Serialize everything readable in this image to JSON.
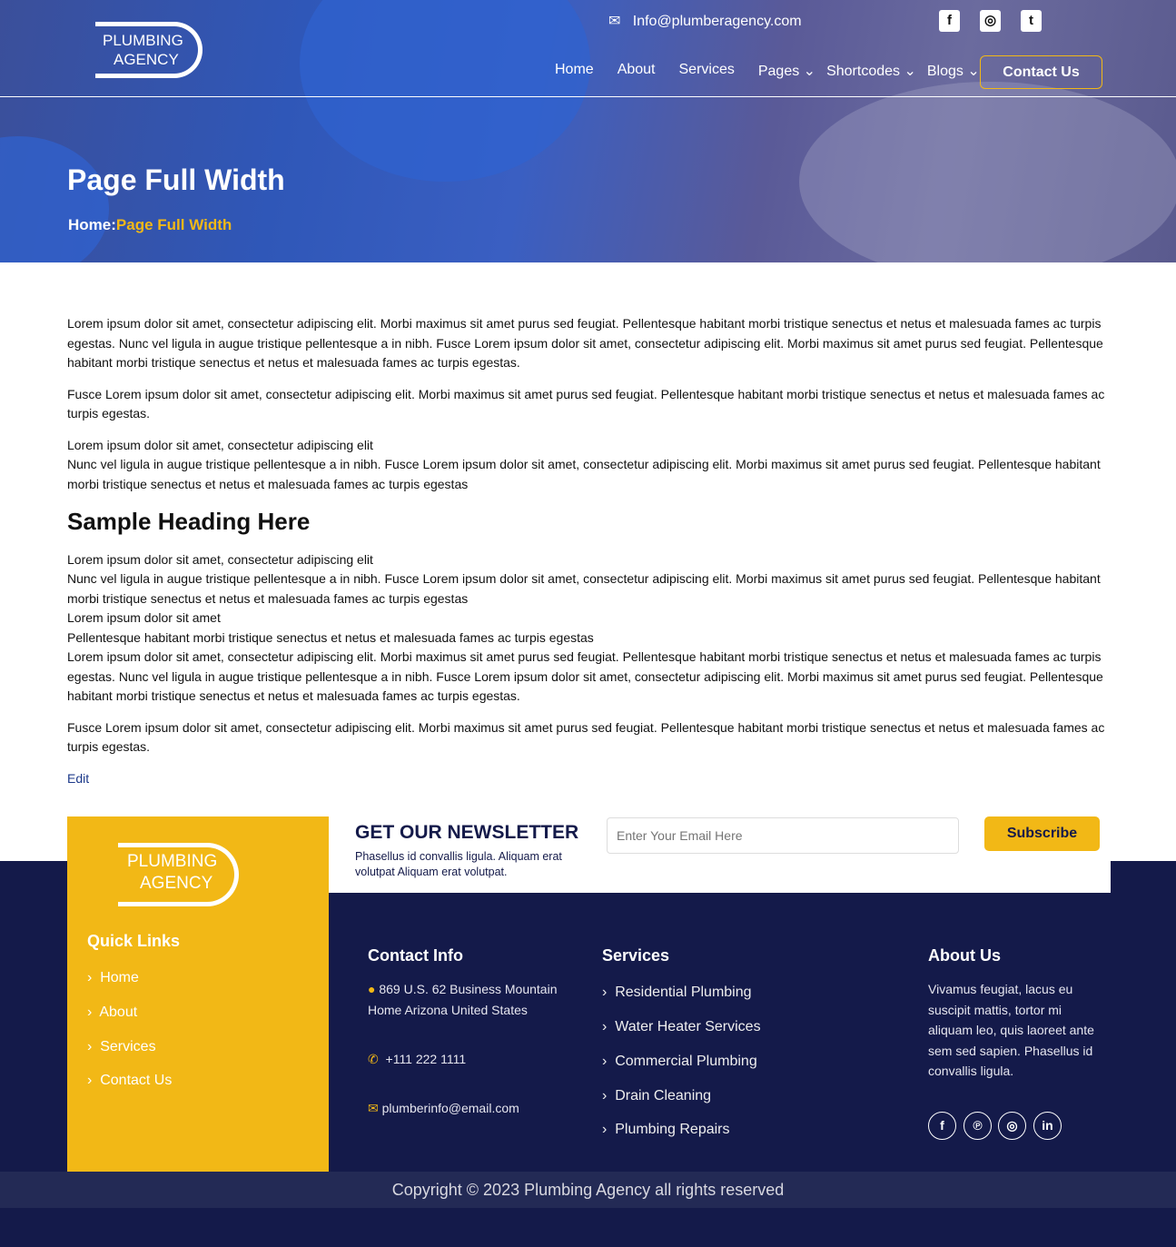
{
  "header": {
    "logo_line1": "PLUMBING",
    "logo_line2": "AGENCY",
    "email": "Info@plumberagency.com",
    "social": [
      "f",
      "◎",
      "t"
    ],
    "nav": [
      {
        "label": "Home"
      },
      {
        "label": "About"
      },
      {
        "label": "Services"
      },
      {
        "label": "Pages ⌄"
      },
      {
        "label": "Shortcodes ⌄"
      },
      {
        "label": "Blogs ⌄"
      }
    ],
    "contact_button": "Contact Us"
  },
  "hero": {
    "title": "Page Full Width",
    "breadcrumb_home": "Home",
    "breadcrumb_sep": ":",
    "breadcrumb_current": "Page Full Width"
  },
  "content": {
    "p1": "Lorem ipsum dolor sit amet, consectetur adipiscing elit. Morbi maximus sit amet purus sed feugiat. Pellentesque habitant morbi tristique senectus et netus et malesuada fames ac turpis egestas. Nunc vel ligula in augue tristique pellentesque a in nibh. Fusce Lorem ipsum dolor sit amet, consectetur adipiscing elit. Morbi maximus sit amet purus sed feugiat. Pellentesque habitant morbi tristique senectus et netus et malesuada fames ac turpis egestas.",
    "p2": "Fusce Lorem ipsum dolor sit amet, consectetur adipiscing elit. Morbi maximus sit amet purus sed feugiat. Pellentesque habitant morbi tristique senectus et netus et malesuada fames ac turpis egestas.",
    "p3a": "Lorem ipsum dolor sit amet, consectetur adipiscing elit",
    "p3b": "Nunc vel ligula in augue tristique pellentesque a in nibh. Fusce Lorem ipsum dolor sit amet, consectetur adipiscing elit. Morbi maximus sit amet purus sed feugiat. Pellentesque habitant morbi tristique senectus et netus et malesuada fames ac turpis egestas",
    "heading": "Sample Heading Here",
    "p4a": "Lorem ipsum dolor sit amet, consectetur adipiscing elit",
    "p4b": "Nunc vel ligula in augue tristique pellentesque a in nibh. Fusce Lorem ipsum dolor sit amet, consectetur adipiscing elit. Morbi maximus sit amet purus sed feugiat. Pellentesque habitant morbi tristique senectus et netus et malesuada fames ac turpis egestas",
    "p4c": "Lorem ipsum dolor sit amet",
    "p4d": "Pellentesque habitant morbi tristique senectus et netus et malesuada fames ac turpis egestas",
    "p4e": "Lorem ipsum dolor sit amet, consectetur adipiscing elit. Morbi maximus sit amet purus sed feugiat. Pellentesque habitant morbi tristique senectus et netus et malesuada fames ac turpis egestas. Nunc vel ligula in augue tristique pellentesque a in nibh. Fusce Lorem ipsum dolor sit amet, consectetur adipiscing elit. Morbi maximus sit amet purus sed feugiat. Pellentesque habitant morbi tristique senectus et netus et malesuada fames ac turpis egestas.",
    "p5": "Fusce Lorem ipsum dolor sit amet, consectetur adipiscing elit. Morbi maximus sit amet purus sed feugiat. Pellentesque habitant morbi tristique senectus et netus et malesuada fames ac turpis egestas.",
    "edit": "Edit"
  },
  "newsletter": {
    "title": "GET OUR NEWSLETTER",
    "text": "Phasellus id convallis ligula. Aliquam erat volutpat Aliquam erat volutpat.",
    "placeholder": "Enter Your Email Here",
    "button": "Subscribe"
  },
  "footer": {
    "quick_links_title": "Quick Links",
    "quick_links": [
      "Home",
      "About",
      "Services",
      "Contact Us"
    ],
    "contact_title": "Contact Info",
    "address": "869 U.S. 62 Business Mountain Home Arizona United States",
    "phone": "+111 222 1111",
    "email": "plumberinfo@email.com",
    "services_title": "Services",
    "services": [
      "Residential Plumbing",
      "Water Heater Services",
      "Commercial Plumbing",
      "Drain Cleaning",
      "Plumbing Repairs"
    ],
    "about_title": "About Us",
    "about_text": "Vivamus feugiat, lacus eu suscipit mattis, tortor mi aliquam leo, quis laoreet ante sem sed sapien. Phasellus id convallis ligula.",
    "social": [
      "f",
      "℗",
      "◎",
      "in"
    ],
    "copyright": "Copyright © 2023 Plumbing Agency all rights reserved"
  },
  "colors": {
    "accent": "#f2b816",
    "footer_bg": "#141a4a",
    "copyright_bg": "#232a55"
  }
}
